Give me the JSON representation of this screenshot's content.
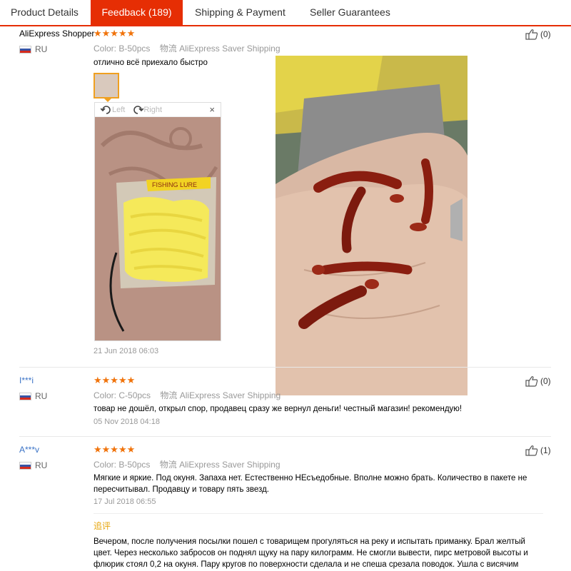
{
  "tabs": [
    {
      "label": "Product Details"
    },
    {
      "label": "Feedback (189)"
    },
    {
      "label": "Shipping & Payment"
    },
    {
      "label": "Seller Guarantees"
    }
  ],
  "colors": {
    "accent": "#e62e04",
    "star": "#f0730b",
    "link": "#3b73c6",
    "reply": "#e6a50b"
  },
  "reviews": [
    {
      "user": "AliExpress Shopper",
      "country": "RU",
      "stars": "★★★★★",
      "color_label": "Color:",
      "color_value": "B-50pcs",
      "logistics_label": "物流",
      "logistics_value": "AliExpress Saver Shipping",
      "text": "отлично всё приехало быстро",
      "date": "21 Jun 2018 06:03",
      "helpful": "(0)"
    },
    {
      "user": "I***i",
      "country": "RU",
      "stars": "★★★★★",
      "color_label": "Color:",
      "color_value": "C-50pcs",
      "logistics_label": "物流",
      "logistics_value": "AliExpress Saver Shipping",
      "text": "товар не дошёл, открыл спор, продавец сразу же вернул деньги! честный магазин! рекомендую!",
      "date": "05 Nov 2018 04:18",
      "helpful": "(0)"
    },
    {
      "user": "A***v",
      "country": "RU",
      "stars": "★★★★★",
      "color_label": "Color:",
      "color_value": "B-50pcs",
      "logistics_label": "物流",
      "logistics_value": "AliExpress Saver Shipping",
      "text": "Мягкие и яркие. Под окуня. Запаха нет. Естественно НЕсъедобные. Вполне можно брать. Количество в пакете не пересчитывал. Продавцу и товару пять звезд.",
      "date": "17 Jul 2018 06:55",
      "helpful": "(1)",
      "reply_label": "追评",
      "reply_text": "Вечером, после получения посылки пошел с товарищем прогуляться на реку и испытать приманку. Брал желтый цвет. Через несколько забросов он поднял щуку на пару килограмм. Не смогли вывести, пирс метровой высоты и флюрик стоял 0,2 на окуня. Пару кругов по поверхности сделала и не спеша срезала поводок. Ушла с висячим"
    }
  ],
  "viewer": {
    "left_label": "Left",
    "right_label": "Right",
    "close": "×"
  },
  "package_label": "FISHING LURE"
}
